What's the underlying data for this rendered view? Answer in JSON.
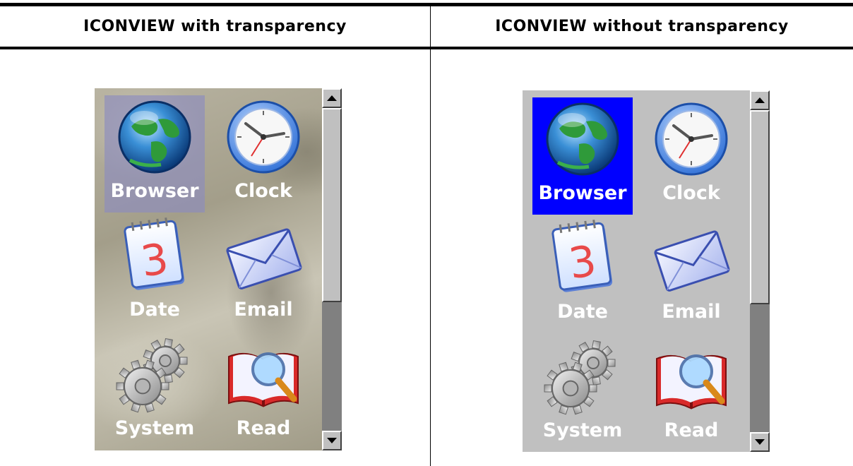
{
  "headers": {
    "left": "ICONVIEW with transparency",
    "right": "ICONVIEW without transparency"
  },
  "colors": {
    "selection_transparent": "#8c8cbe",
    "selection_opaque": "#0000ff",
    "opaque_background": "#c0c0c0",
    "label": "#ffffff",
    "scrollbar_track": "#808080"
  },
  "iconviews": [
    {
      "mode": "with transparency",
      "selected_index": 0,
      "icons": [
        {
          "label": "Browser",
          "icon": "globe-icon"
        },
        {
          "label": "Clock",
          "icon": "clock-icon"
        },
        {
          "label": "Date",
          "icon": "calendar-icon",
          "calendar_day": "3"
        },
        {
          "label": "Email",
          "icon": "envelope-icon"
        },
        {
          "label": "System",
          "icon": "gears-icon"
        },
        {
          "label": "Read",
          "icon": "book-magnifier-icon"
        }
      ]
    },
    {
      "mode": "without transparency",
      "selected_index": 0,
      "icons": [
        {
          "label": "Browser",
          "icon": "globe-icon"
        },
        {
          "label": "Clock",
          "icon": "clock-icon"
        },
        {
          "label": "Date",
          "icon": "calendar-icon",
          "calendar_day": "3"
        },
        {
          "label": "Email",
          "icon": "envelope-icon"
        },
        {
          "label": "System",
          "icon": "gears-icon"
        },
        {
          "label": "Read",
          "icon": "book-magnifier-icon"
        }
      ]
    }
  ]
}
